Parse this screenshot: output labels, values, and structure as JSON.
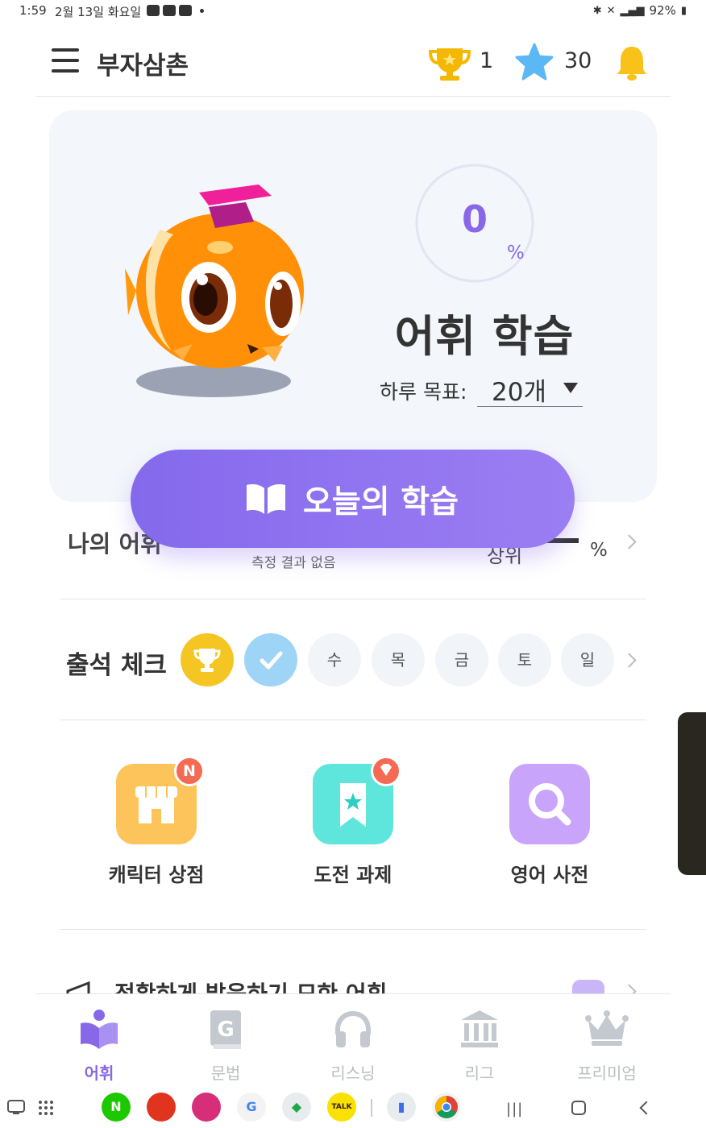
{
  "status_bar": {
    "time": "1:59",
    "date": "2월 13일 화요일",
    "battery": "92%"
  },
  "header": {
    "title": "부자삼촌",
    "trophy_count": "1",
    "star_count": "30"
  },
  "hero": {
    "progress_value": "0",
    "progress_unit": "%",
    "progress_fraction": 0,
    "title": "어휘 학습",
    "goal_label": "하루 목표:",
    "goal_value": "20개"
  },
  "cta": {
    "label": "오늘의 학습"
  },
  "vocab_row": {
    "title": "나의 어휘",
    "subtitle": "측정 결과 없음",
    "rank_label": "상위",
    "percent_unit": "%"
  },
  "attendance": {
    "title": "출석 체크",
    "days": [
      "수",
      "목",
      "금",
      "토",
      "일"
    ]
  },
  "shortcuts": [
    {
      "label": "캐릭터 상점",
      "badge": "N"
    },
    {
      "label": "도전 과제",
      "badge": ""
    },
    {
      "label": "영어 사전",
      "badge": ""
    }
  ],
  "next_section": {
    "title": "정확하게 발음하기 모한 어휘"
  },
  "bottom_nav": {
    "items": [
      "어휘",
      "문법",
      "리스닝",
      "리그",
      "프리미엄"
    ],
    "active_index": 0
  },
  "dock_apps": [
    {
      "name": "naver",
      "label": "N",
      "color": "#1ec800"
    },
    {
      "name": "kakao-talk",
      "label": "TALK",
      "color": "#fae100"
    }
  ],
  "colors": {
    "accent": "#8868e8",
    "gold": "#f5c623",
    "check_blue": "#9ed4f5",
    "shop_orange": "#fcc45a",
    "challenge_teal": "#5ee6dc",
    "dictionary_purple": "#c9a4fb"
  }
}
